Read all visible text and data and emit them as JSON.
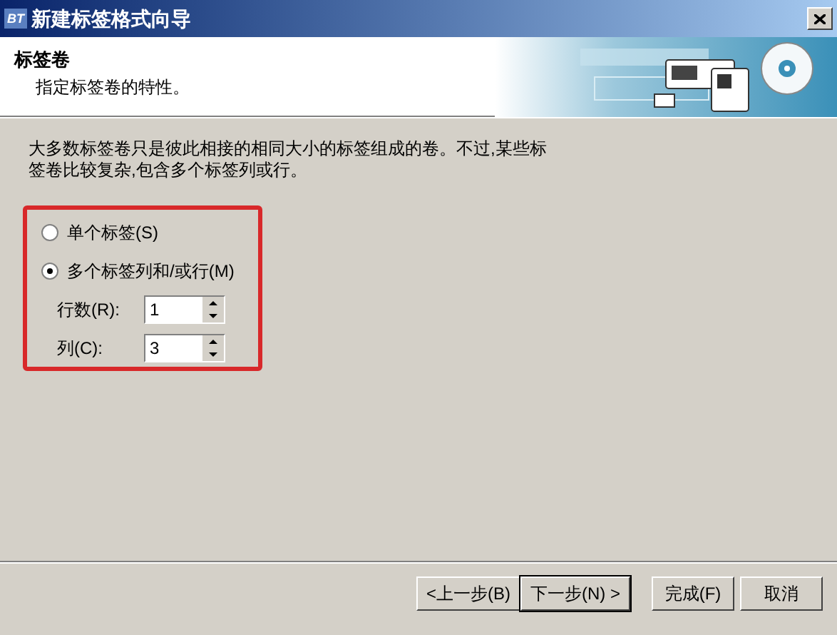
{
  "window": {
    "title": "新建标签格式向导",
    "logo": "BT"
  },
  "header": {
    "title": "标签卷",
    "subtitle": "指定标签卷的特性。"
  },
  "description": "大多数标签卷只是彼此相接的相同大小的标签组成的卷。不过,某些标签卷比较复杂,包含多个标签列或行。",
  "options": [
    {
      "label": "单个标签(S)",
      "selected": false
    },
    {
      "label": "多个标签列和/或行(M)",
      "selected": true
    }
  ],
  "fields": [
    {
      "label": "行数(R):",
      "value": "1"
    },
    {
      "label": "列(C):",
      "value": "3"
    }
  ],
  "buttons": [
    {
      "label": "<上一步(B)",
      "default": false
    },
    {
      "label": "下一步(N) >",
      "default": true
    },
    {
      "label": "完成(F)",
      "default": false
    },
    {
      "label": "取消",
      "default": false
    }
  ]
}
